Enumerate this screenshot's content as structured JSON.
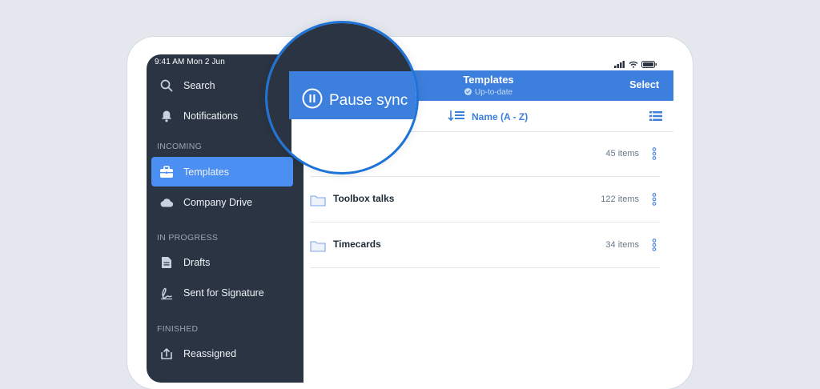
{
  "status_bar": {
    "time": "9:41 AM  Mon 2 Jun"
  },
  "sidebar": {
    "items_top": [
      {
        "label": "Search",
        "icon": "search-icon"
      },
      {
        "label": "Notifications",
        "icon": "bell-icon"
      }
    ],
    "sections": {
      "incoming": "INCOMING",
      "in_progress": "IN PROGRESS",
      "finished": "FINISHED"
    },
    "incoming_items": [
      {
        "label": "Templates",
        "icon": "briefcase-icon",
        "active": true
      },
      {
        "label": "Company Drive",
        "icon": "cloud-icon"
      }
    ],
    "progress_items": [
      {
        "label": "Drafts",
        "icon": "document-icon"
      },
      {
        "label": "Sent for Signature",
        "icon": "signature-icon"
      }
    ],
    "finished_items": [
      {
        "label": "Reassigned",
        "icon": "reassign-icon"
      }
    ]
  },
  "header": {
    "title": "Templates",
    "status": "Up-to-date",
    "select_label": "Select"
  },
  "sort": {
    "label": "Name (A - Z)"
  },
  "folders": [
    {
      "name": "",
      "count": "45 items"
    },
    {
      "name": "Toolbox talks",
      "count": "122 items"
    },
    {
      "name": "Timecards",
      "count": "34 items"
    }
  ],
  "magnifier": {
    "label": "Pause sync"
  },
  "colors": {
    "accent": "#3d7fdc",
    "sidebar": "#2a3442",
    "active": "#4b8ff3",
    "ring": "#1e73d8"
  }
}
